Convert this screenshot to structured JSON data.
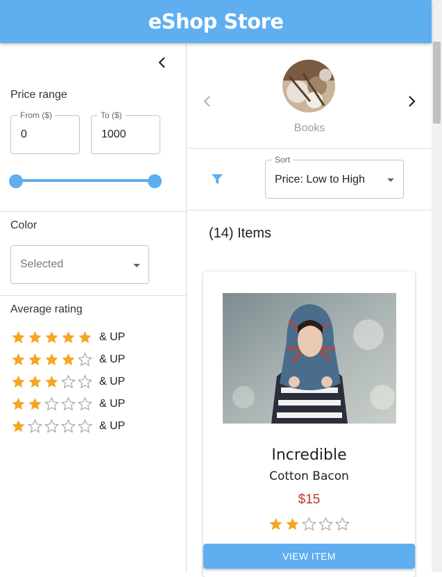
{
  "app": {
    "title": "eShop Store"
  },
  "filters": {
    "price_range": {
      "label": "Price range",
      "from_label": "From ($)",
      "from_value": "0",
      "to_label": "To ($)",
      "to_value": "1000",
      "slider_min": 0,
      "slider_max": 1000
    },
    "color": {
      "label": "Color",
      "placeholder": "Selected"
    },
    "average_rating": {
      "label": "Average rating",
      "options": [
        {
          "stars": 5,
          "suffix": "& UP"
        },
        {
          "stars": 4,
          "suffix": "& UP"
        },
        {
          "stars": 3,
          "suffix": "& UP"
        },
        {
          "stars": 2,
          "suffix": "& UP"
        },
        {
          "stars": 1,
          "suffix": "& UP"
        }
      ]
    }
  },
  "category": {
    "name": "Books"
  },
  "sort": {
    "label": "Sort",
    "value": "Price: Low to High"
  },
  "items_count": "(14) Items",
  "products": [
    {
      "title": "Incredible",
      "subtitle": "Cotton Bacon",
      "price": "$15",
      "rating": 2,
      "max_rating": 5,
      "button": "VIEW ITEM"
    }
  ],
  "icons": {
    "collapse": "chevron-left-icon",
    "prev": "chevron-left-icon",
    "next": "chevron-right-icon",
    "filter": "filter-icon",
    "star": "star-icon"
  },
  "colors": {
    "brand": "#5eaef0",
    "star": "#f5a623",
    "star_empty": "#9e9e9e",
    "price": "#c0392b"
  }
}
